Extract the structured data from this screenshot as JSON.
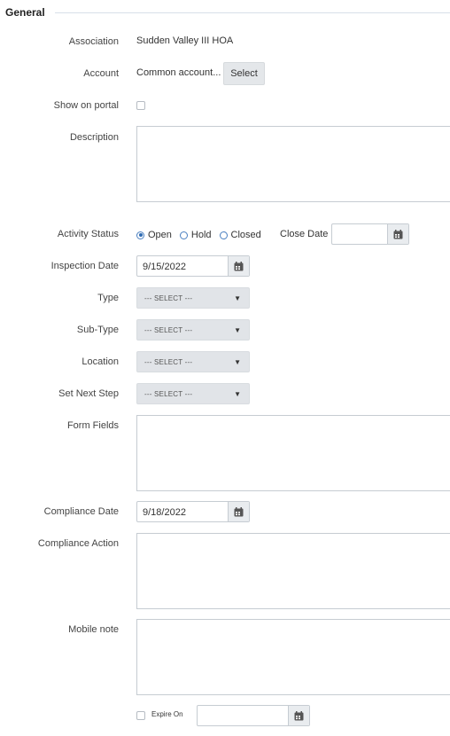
{
  "section": {
    "title": "General"
  },
  "fields": {
    "association": {
      "label": "Association",
      "value": "Sudden Valley III HOA"
    },
    "account": {
      "label": "Account",
      "value": "Common account...",
      "button": "Select"
    },
    "show_on_portal": {
      "label": "Show on portal",
      "checked": false
    },
    "description": {
      "label": "Description",
      "value": ""
    },
    "activity_status": {
      "label": "Activity Status",
      "options": [
        "Open",
        "Hold",
        "Closed"
      ],
      "selected": "Open",
      "close_date_label": "Close Date",
      "close_date_value": ""
    },
    "inspection_date": {
      "label": "Inspection Date",
      "value": "9/15/2022"
    },
    "type": {
      "label": "Type",
      "value": "--- SELECT ---"
    },
    "sub_type": {
      "label": "Sub-Type",
      "value": "--- SELECT ---"
    },
    "location": {
      "label": "Location",
      "value": "--- SELECT ---"
    },
    "set_next_step": {
      "label": "Set Next Step",
      "value": "--- SELECT ---"
    },
    "form_fields": {
      "label": "Form Fields",
      "value": ""
    },
    "compliance_date": {
      "label": "Compliance Date",
      "value": "9/18/2022"
    },
    "compliance_action": {
      "label": "Compliance Action",
      "value": ""
    },
    "mobile_note": {
      "label": "Mobile note",
      "value": ""
    },
    "expire_on": {
      "label": "Expire On",
      "checked": false,
      "value": ""
    }
  },
  "icons": {
    "calendar": "calendar-icon",
    "caret": "chevron-down-icon"
  },
  "colors": {
    "accent": "#2f6bb3",
    "select_bg": "#e1e4e8",
    "button_bg": "#e4e7ea"
  }
}
